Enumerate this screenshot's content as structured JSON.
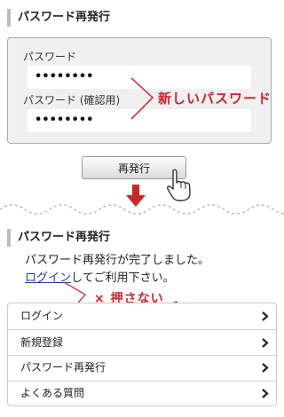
{
  "section1": {
    "heading": "パスワード再発行",
    "password_label": "パスワード",
    "password_value": "••••••••",
    "confirm_label": "パスワード (確認用)",
    "confirm_value": "••••••••",
    "annotation": "新しいパスワード",
    "reissue_button": "再発行"
  },
  "section2": {
    "heading": "パスワード再発行",
    "message_line1": "パスワード再発行が完了しました。",
    "login_link": "ログイン",
    "message_line2_rest": "してご利用下さい。",
    "annotation": "× 押さない"
  },
  "menu": {
    "items": [
      {
        "label": "ログイン"
      },
      {
        "label": "新規登録"
      },
      {
        "label": "パスワード再発行"
      },
      {
        "label": "よくある質問"
      }
    ]
  },
  "colors": {
    "accent_red": "#d3202a",
    "link_blue": "#1a3fa8",
    "box_bg": "#f0f0f0",
    "heading_bar": "#bdbdbd"
  },
  "icons": [
    "pointing-hand-icon",
    "down-arrow-icon",
    "chevron-right-icon"
  ]
}
